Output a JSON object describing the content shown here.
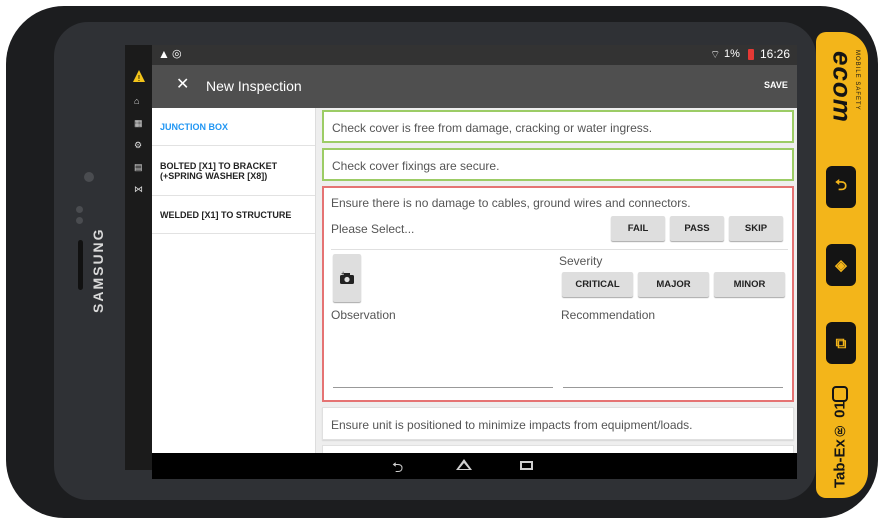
{
  "device": {
    "brand": "SAMSUNG",
    "accessory_logo": "ecom",
    "accessory_tagline": "MOBILE SAFETY",
    "model": "Tab-Ex® 01"
  },
  "status_bar": {
    "battery_percent": "1%",
    "time": "16:26",
    "icons": [
      "warning-icon",
      "sync-icon",
      "wifi-icon",
      "battery-icon"
    ]
  },
  "app_bar": {
    "close_icon": "close-icon",
    "title": "New Inspection",
    "save_label": "SAVE"
  },
  "left_rail_icons": [
    "hazard-icon",
    "home-icon",
    "grid-icon",
    "settings-icon",
    "document-icon",
    "share-icon"
  ],
  "sidebar": {
    "items": [
      {
        "label": "JUNCTION BOX",
        "selected": true
      },
      {
        "label": "BOLTED [X1] TO BRACKET (+SPRING WASHER [X8])",
        "selected": false
      },
      {
        "label": "WELDED [X1] TO STRUCTURE",
        "selected": false
      }
    ]
  },
  "checks": [
    {
      "text": "Check cover is free from damage, cracking or water ingress.",
      "status": "pass"
    },
    {
      "text": "Check cover fixings are secure.",
      "status": "pass"
    },
    {
      "text": "Ensure there is no damage to cables, ground wires and connectors.",
      "status": "fail"
    },
    {
      "text": "Ensure unit is positioned to minimize impacts from equipment/loads.",
      "status": "none"
    }
  ],
  "expanded_check": {
    "placeholder": "Please Select...",
    "result_buttons": [
      "FAIL",
      "PASS",
      "SKIP"
    ],
    "severity_label": "Severity",
    "severity_buttons": [
      "CRITICAL",
      "MAJOR",
      "MINOR"
    ],
    "observation_label": "Observation",
    "recommendation_label": "Recommendation",
    "camera_icon": "add-photo-icon"
  },
  "colors": {
    "accent": "#2196f3",
    "pass_border": "#9ccc65",
    "fail_border": "#e57373",
    "app_bar": "#4f4f4f",
    "grip": "#f3b51a"
  },
  "nav_icons": [
    "back-icon",
    "home-icon",
    "recents-icon"
  ]
}
